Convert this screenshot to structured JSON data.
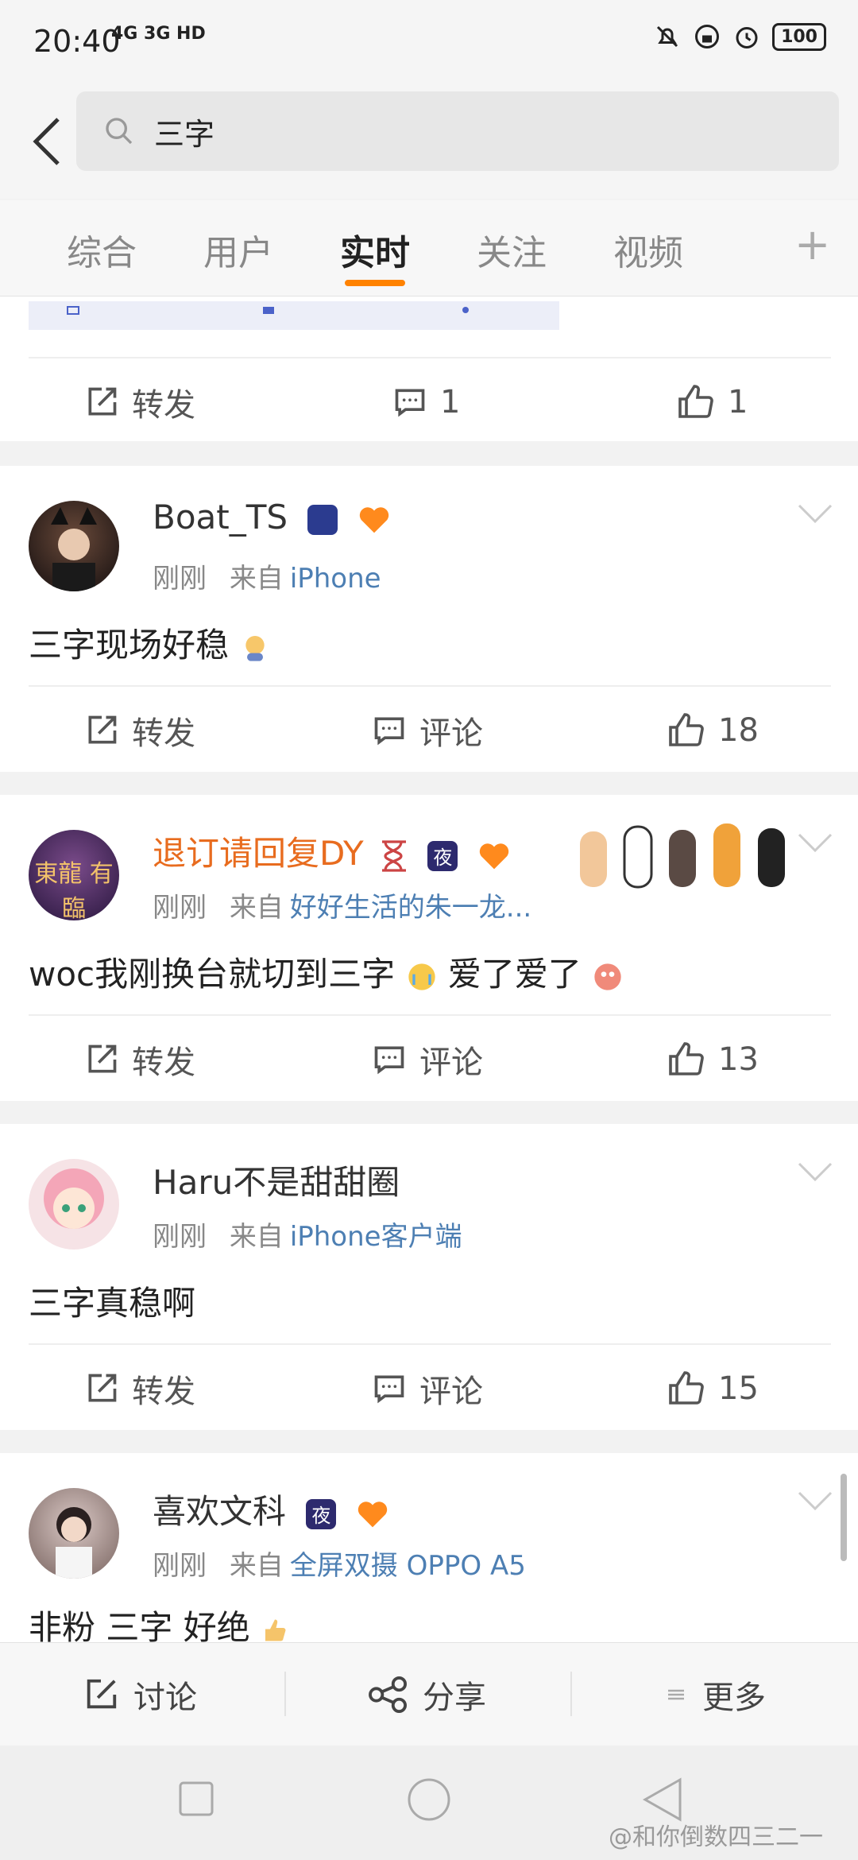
{
  "status": {
    "time": "20:40",
    "network": "4G 3G HD",
    "battery": "100"
  },
  "search": {
    "query": "三字"
  },
  "tabs": [
    {
      "label": "综合"
    },
    {
      "label": "用户"
    },
    {
      "label": "实时"
    },
    {
      "label": "关注"
    },
    {
      "label": "视频"
    }
  ],
  "colors": {
    "accent": "#ff8200",
    "link": "#4d7fb3",
    "orange_name": "#e86c1f"
  },
  "post0": {
    "repost": "转发",
    "comments": "1",
    "likes": "1"
  },
  "posts": [
    {
      "name": "Boat_TS",
      "time": "刚刚",
      "from_label": "来自",
      "source": "iPhone",
      "text": "三字现场好稳",
      "repost": "转发",
      "comment": "评论",
      "likes": "18"
    },
    {
      "name": "退订请回复DY",
      "time": "刚刚",
      "from_label": "来自",
      "source": "好好生活的朱一龙...",
      "text": "woc我刚换台就切到三字",
      "text_tail": "爱了爱了",
      "avatar_text": "東龍 有臨",
      "badge_text": "夜",
      "repost": "转发",
      "comment": "评论",
      "likes": "13"
    },
    {
      "name": "Haru不是甜甜圈",
      "time": "刚刚",
      "from_label": "来自",
      "source": "iPhone客户端",
      "text": "三字真稳啊",
      "repost": "转发",
      "comment": "评论",
      "likes": "15"
    },
    {
      "name": "喜欢文科",
      "time": "刚刚",
      "from_label": "来自",
      "source": "全屏双摄 OPPO A5",
      "text": "非粉 三字 好绝",
      "badge_text": "夜"
    }
  ],
  "bottom": {
    "discuss": "讨论",
    "share": "分享",
    "more": "更多"
  },
  "watermark": "@和你倒数四三二一"
}
